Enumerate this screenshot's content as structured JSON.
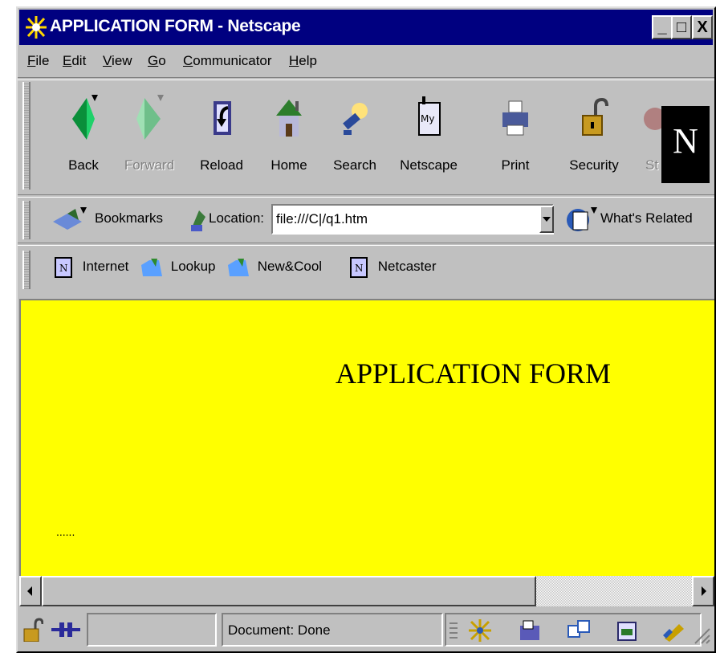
{
  "window": {
    "title": "APPLICATION FORM - Netscape",
    "minimize_glyph": "_",
    "maximize_glyph": "□",
    "close_glyph": "X"
  },
  "menu": [
    {
      "label": "File",
      "hotkey": "F",
      "rest": "ile"
    },
    {
      "label": "Edit",
      "hotkey": "E",
      "rest": "dit"
    },
    {
      "label": "View",
      "hotkey": "V",
      "rest": "iew"
    },
    {
      "label": "Go",
      "hotkey": "G",
      "rest": "o"
    },
    {
      "label": "Communicator",
      "hotkey": "C",
      "rest": "ommunicator"
    },
    {
      "label": "Help",
      "hotkey": "H",
      "rest": "elp"
    }
  ],
  "navigation": {
    "back": "Back",
    "forward": "Forward",
    "reload": "Reload",
    "home": "Home",
    "search": "Search",
    "netscape": "Netscape",
    "print": "Print",
    "security": "Security",
    "stop_partial": "St"
  },
  "logo_letter": "N",
  "location_bar": {
    "bookmarks": "Bookmarks",
    "location_label": "Location:",
    "url": "file:///C|/q1.htm",
    "whats_related": "What's Related"
  },
  "personal_toolbar": [
    {
      "label": "Internet",
      "icon": "netscape-page-icon"
    },
    {
      "label": "Lookup",
      "icon": "folder-icon"
    },
    {
      "label": "New&Cool",
      "icon": "folder-icon"
    },
    {
      "label": "Netcaster",
      "icon": "netscape-page-icon"
    }
  ],
  "page": {
    "heading": "APPLICATION FORM",
    "dots": "......",
    "background": "#ffff00"
  },
  "scrollbar": {
    "left_arrow": "◀",
    "right_arrow": "▶",
    "thumb_fraction": 0.76
  },
  "status": {
    "text": "Document: Done"
  },
  "colors": {
    "titlebar": "#000080",
    "chrome": "#c0c0c0"
  }
}
